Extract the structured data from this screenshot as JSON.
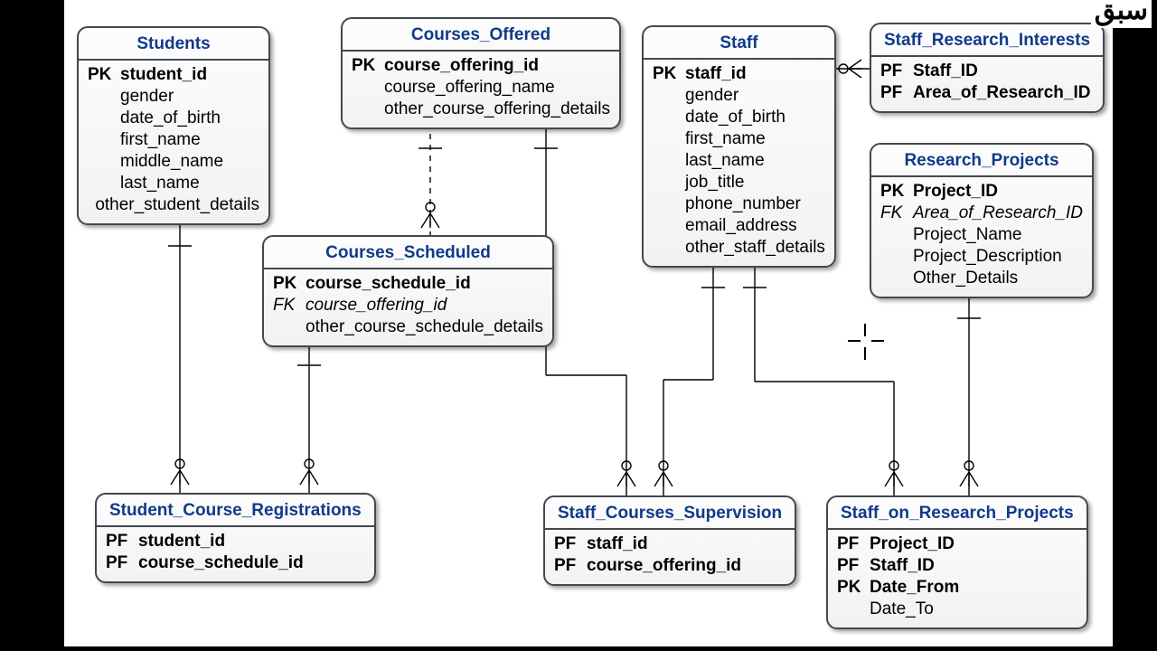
{
  "watermark": "سبق",
  "entities": {
    "students": {
      "title": "Students",
      "rows": [
        {
          "key": "PK",
          "name": "student_id",
          "kind": "pk"
        },
        {
          "key": "",
          "name": "gender",
          "kind": ""
        },
        {
          "key": "",
          "name": "date_of_birth",
          "kind": ""
        },
        {
          "key": "",
          "name": "first_name",
          "kind": ""
        },
        {
          "key": "",
          "name": "middle_name",
          "kind": ""
        },
        {
          "key": "",
          "name": "last_name",
          "kind": ""
        },
        {
          "key": "",
          "name": "other_student_details",
          "kind": ""
        }
      ]
    },
    "courses_offered": {
      "title": "Courses_Offered",
      "rows": [
        {
          "key": "PK",
          "name": "course_offering_id",
          "kind": "pk"
        },
        {
          "key": "",
          "name": "course_offering_name",
          "kind": ""
        },
        {
          "key": "",
          "name": "other_course_offering_details",
          "kind": ""
        }
      ]
    },
    "staff": {
      "title": "Staff",
      "rows": [
        {
          "key": "PK",
          "name": "staff_id",
          "kind": "pk"
        },
        {
          "key": "",
          "name": "gender",
          "kind": ""
        },
        {
          "key": "",
          "name": "date_of_birth",
          "kind": ""
        },
        {
          "key": "",
          "name": "first_name",
          "kind": ""
        },
        {
          "key": "",
          "name": "last_name",
          "kind": ""
        },
        {
          "key": "",
          "name": "job_title",
          "kind": ""
        },
        {
          "key": "",
          "name": "phone_number",
          "kind": ""
        },
        {
          "key": "",
          "name": "email_address",
          "kind": ""
        },
        {
          "key": "",
          "name": "other_staff_details",
          "kind": ""
        }
      ]
    },
    "sri": {
      "title": "Staff_Research_Interests",
      "rows": [
        {
          "key": "PF",
          "name": "Staff_ID",
          "kind": "pk"
        },
        {
          "key": "PF",
          "name": "Area_of_Research_ID",
          "kind": "pk"
        }
      ]
    },
    "research_projects": {
      "title": "Research_Projects",
      "rows": [
        {
          "key": "PK",
          "name": "Project_ID",
          "kind": "pk"
        },
        {
          "key": "FK",
          "name": "Area_of_Research_ID",
          "kind": "fk"
        },
        {
          "key": "",
          "name": "Project_Name",
          "kind": ""
        },
        {
          "key": "",
          "name": "Project_Description",
          "kind": ""
        },
        {
          "key": "",
          "name": "Other_Details",
          "kind": ""
        }
      ]
    },
    "courses_scheduled": {
      "title": "Courses_Scheduled",
      "rows": [
        {
          "key": "PK",
          "name": "course_schedule_id",
          "kind": "pk"
        },
        {
          "key": "FK",
          "name": "course_offering_id",
          "kind": "fk"
        },
        {
          "key": "",
          "name": "other_course_schedule_details",
          "kind": ""
        }
      ]
    },
    "scr": {
      "title": "Student_Course_Registrations",
      "rows": [
        {
          "key": "PF",
          "name": "student_id",
          "kind": "pk"
        },
        {
          "key": "PF",
          "name": "course_schedule_id",
          "kind": "pk"
        }
      ]
    },
    "scs": {
      "title": "Staff_Courses_Supervision",
      "rows": [
        {
          "key": "PF",
          "name": "staff_id",
          "kind": "pk"
        },
        {
          "key": "PF",
          "name": "course_offering_id",
          "kind": "pk"
        }
      ]
    },
    "sorp": {
      "title": "Staff_on_Research_Projects",
      "rows": [
        {
          "key": "PF",
          "name": "Project_ID",
          "kind": "pk"
        },
        {
          "key": "PF",
          "name": "Staff_ID",
          "kind": "pk"
        },
        {
          "key": "PK",
          "name": "Date_From",
          "kind": "pk"
        },
        {
          "key": "",
          "name": "Date_To",
          "kind": ""
        }
      ]
    }
  }
}
